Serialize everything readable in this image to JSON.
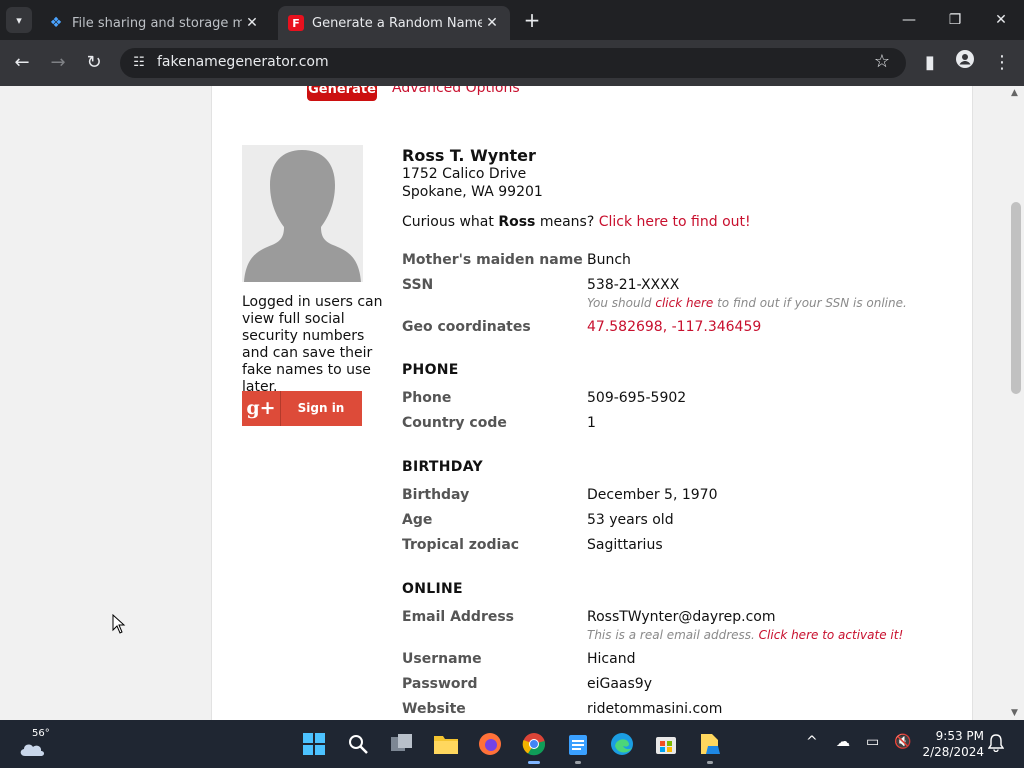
{
  "browser": {
    "tabs": [
      {
        "title": "File sharing and storage made s",
        "active": false
      },
      {
        "title": "Generate a Random Name - Fak",
        "active": true
      }
    ],
    "url": "fakenamegenerator.com"
  },
  "page": {
    "generate_label": "Generate",
    "advanced_label": "Advanced Options",
    "login_note": "Logged in users can view full social security numbers and can save their fake names to use later.",
    "signin_label": "Sign in",
    "signin_glyph": "g+",
    "name": "Ross T. Wynter",
    "address_line1": "1752 Calico Drive",
    "address_line2": "Spokane, WA 99201",
    "curious_prefix": "Curious what ",
    "curious_name": "Ross",
    "curious_mid": " means? ",
    "curious_link": "Click here to find out!",
    "fields": {
      "maiden_label": "Mother's maiden name",
      "maiden_value": "Bunch",
      "ssn_label": "SSN",
      "ssn_value": "538-21-XXXX",
      "ssn_note_prefix": "You should ",
      "ssn_note_link": "click here",
      "ssn_note_suffix": " to find out if your SSN is online.",
      "geo_label": "Geo coordinates",
      "geo_value": "47.582698, -117.346459"
    },
    "phone": {
      "heading": "PHONE",
      "phone_label": "Phone",
      "phone_value": "509-695-5902",
      "cc_label": "Country code",
      "cc_value": "1"
    },
    "birthday": {
      "heading": "BIRTHDAY",
      "bday_label": "Birthday",
      "bday_value": "December 5, 1970",
      "age_label": "Age",
      "age_value": "53 years old",
      "zodiac_label": "Tropical zodiac",
      "zodiac_value": "Sagittarius"
    },
    "online": {
      "heading": "ONLINE",
      "email_label": "Email Address",
      "email_value": "RossTWynter@dayrep.com",
      "email_note": "This is a real email address. ",
      "email_note_link": "Click here to activate it!",
      "user_label": "Username",
      "user_value": "Hicand",
      "pass_label": "Password",
      "pass_value": "eiGaas9y",
      "web_label": "Website",
      "web_value": "ridetommasini.com"
    }
  },
  "taskbar": {
    "weather_temp": "56°",
    "time": "9:53 PM",
    "date": "2/28/2024"
  },
  "colors": {
    "accent_red": "#c8102e",
    "chrome_dark": "#202124",
    "taskbar": "#1f2632"
  }
}
